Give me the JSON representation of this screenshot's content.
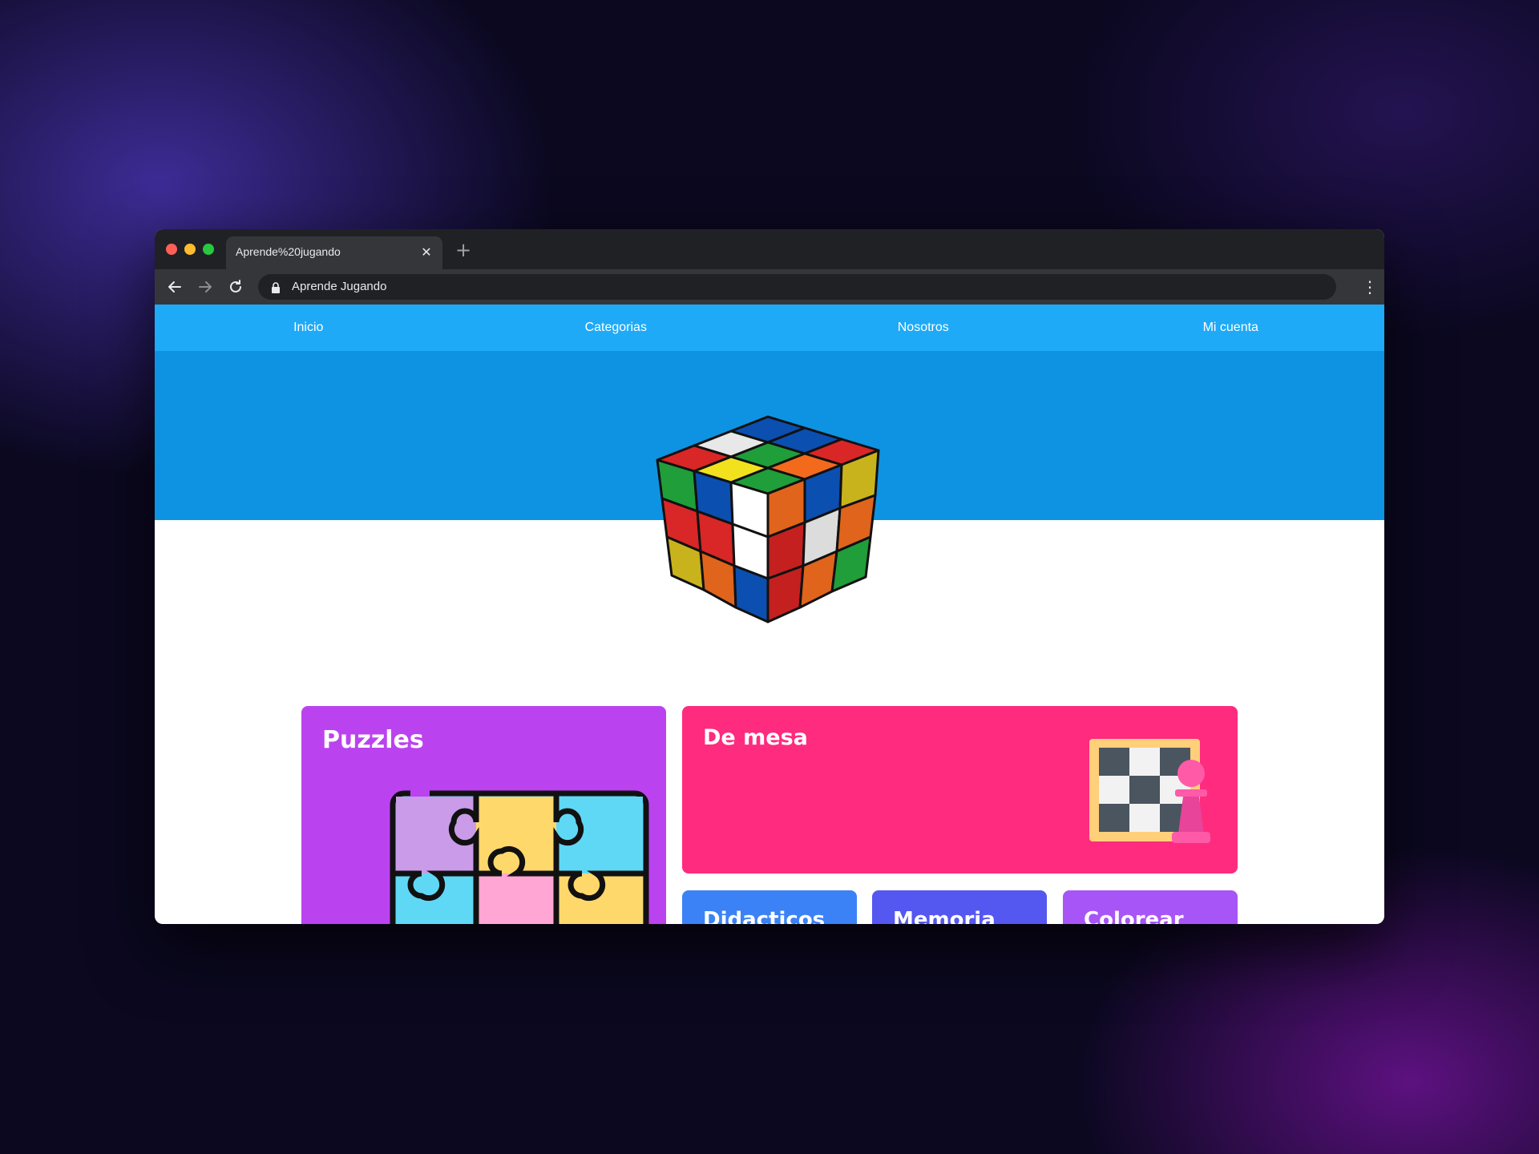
{
  "browser": {
    "tab_title": "Aprende%20jugando",
    "tab_close_icon": "close-icon",
    "new_tab_label": "+",
    "address": "Aprende Jugando"
  },
  "site": {
    "nav": [
      {
        "label": "Inicio"
      },
      {
        "label": "Categorias"
      },
      {
        "label": "Nosotros"
      },
      {
        "label": "Mi cuenta"
      }
    ],
    "hero_image": "rubiks-cube",
    "categories": [
      {
        "title": "Puzzles",
        "color": "#bb43ef",
        "icon": "puzzle-icon"
      },
      {
        "title": "De mesa",
        "color": "#fe2b7e",
        "icon": "chess-board-icon"
      },
      {
        "title": "Didacticos",
        "color": "#3b82f6"
      },
      {
        "title": "Memoria",
        "color": "#5457f0"
      },
      {
        "title": "Colorear",
        "color": "#a855f7"
      }
    ]
  },
  "colors": {
    "nav_bar": "#1eaaf7",
    "hero_band": "#0e93e2",
    "browser_chrome": "#202124"
  }
}
